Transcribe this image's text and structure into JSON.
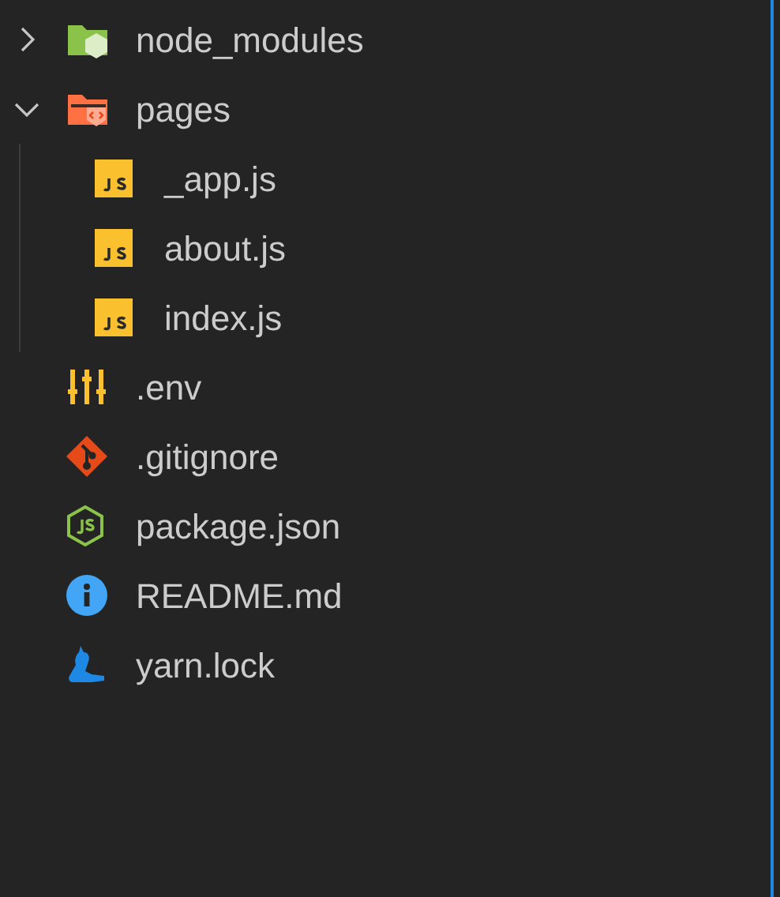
{
  "tree": [
    {
      "kind": "modules",
      "name": "node_modules",
      "expanded": false
    },
    {
      "kind": "pages",
      "name": "pages",
      "expanded": true,
      "children": [
        {
          "kind": "js",
          "name": "_app.js"
        },
        {
          "kind": "js",
          "name": "about.js"
        },
        {
          "kind": "js",
          "name": "index.js"
        }
      ]
    },
    {
      "kind": "env",
      "name": ".env"
    },
    {
      "kind": "git",
      "name": ".gitignore"
    },
    {
      "kind": "npm",
      "name": "package.json"
    },
    {
      "kind": "info",
      "name": "README.md"
    },
    {
      "kind": "yarn",
      "name": "yarn.lock"
    }
  ]
}
